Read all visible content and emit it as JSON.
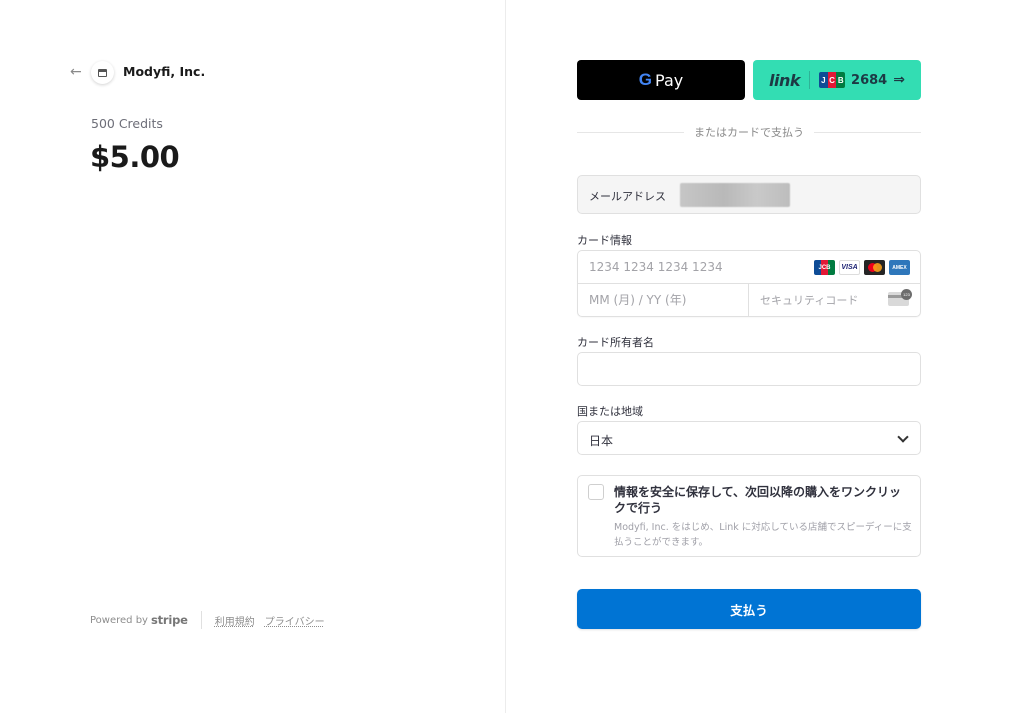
{
  "merchant": {
    "name": "Modyfi, Inc.",
    "back_icon": "arrow-left-icon",
    "logo_icon": "store-icon"
  },
  "product": {
    "name": "500 Credits",
    "price": "$5.00"
  },
  "footer": {
    "powered_by": "Powered by",
    "stripe": "stripe",
    "terms": "利用規約",
    "privacy": "プライバシー"
  },
  "wallet": {
    "gpay_label": "Pay",
    "link_label": "link",
    "link_card_last4": "2684",
    "link_arrow": "⇒"
  },
  "divider_text": "またはカードで支払う",
  "email": {
    "label": "メールアドレス"
  },
  "card": {
    "label": "カード情報",
    "number_placeholder": "1234 1234 1234 1234",
    "expiry_placeholder": "MM (月) / YY (年)",
    "cvc_placeholder": "セキュリティコード",
    "brands": [
      "JCB",
      "VISA",
      "Mastercard",
      "American Express"
    ]
  },
  "cardholder": {
    "label": "カード所有者名",
    "value": ""
  },
  "country": {
    "label": "国または地域",
    "selected": "日本"
  },
  "save_info": {
    "title": "情報を安全に保存して、次回以降の購入をワンクリックで行う",
    "description": "Modyfi, Inc. をはじめ、Link に対応している店舗でスピーディーに支払うことができます。",
    "checked": false
  },
  "pay_button": "支払う",
  "colors": {
    "pay_button": "#0074d4",
    "link_button": "#33ddb3",
    "gpay_button": "#000000"
  }
}
